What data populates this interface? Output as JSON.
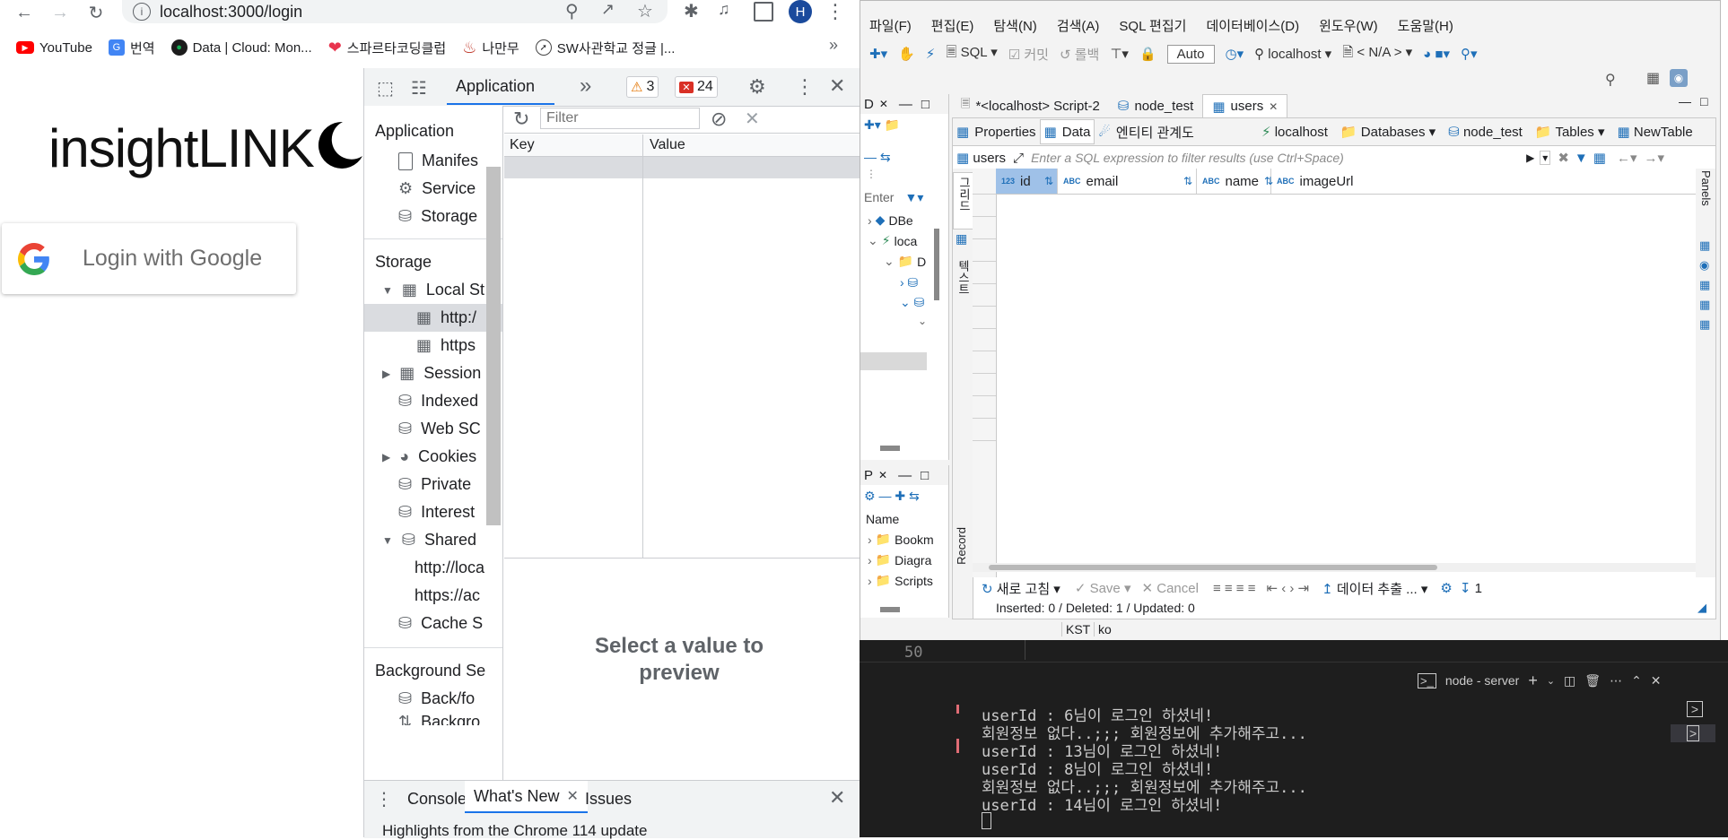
{
  "chrome": {
    "url": "localhost:3000/login",
    "profile_initial": "H",
    "bookmarks": [
      "YouTube",
      "번역",
      "Data | Cloud: Mon...",
      "스파르타코딩클럽",
      "나만무",
      "SW사관학교 정글 |..."
    ],
    "more": "»"
  },
  "page": {
    "logo_text": "insightLINK",
    "login_button": "Login with Google"
  },
  "devtools": {
    "active_tab": "Application",
    "warnings": "3",
    "errors": "24",
    "sidebar": {
      "application_header": "Application",
      "application_items": [
        "Manifes",
        "Service",
        "Storage"
      ],
      "storage_header": "Storage",
      "storage_items": [
        "Local St",
        "http:/",
        "https",
        "Session",
        "Indexed",
        "Web SC",
        "Cookies",
        "Private",
        "Interest",
        "Shared",
        "http://loca",
        "https://ac",
        "Cache S"
      ],
      "background_header": "Background Se",
      "background_items": [
        "Back/fo",
        "Backgro"
      ]
    },
    "filter_placeholder": "Filter",
    "columns": {
      "key": "Key",
      "value": "Value"
    },
    "preview_text": "Select a value to preview",
    "drawer_tabs": [
      "Console",
      "What's New",
      "Issues"
    ],
    "drawer_hint": "Highlights from the Chrome 114 update"
  },
  "dbeaver": {
    "menu": [
      "파일(F)",
      "편집(E)",
      "탐색(N)",
      "검색(A)",
      "SQL 편집기",
      "데이터베이스(D)",
      "윈도우(W)",
      "도움말(H)"
    ],
    "toolbar": {
      "sql": "SQL",
      "commit": "커밋",
      "rollback": "롤백",
      "mode": "Auto",
      "connection": "localhost",
      "schema": "< N/A >"
    },
    "nav_panel_title": "D",
    "nav_filter_placeholder": "Enter",
    "nav_items": [
      "DBe",
      "loca",
      "D"
    ],
    "project_panel_title": "P",
    "project_header": "Name",
    "project_items": [
      "Bookm",
      "Diagra",
      "Scripts"
    ],
    "editor_tabs": [
      "*<localhost> Script-2",
      "node_test",
      "users"
    ],
    "sub_tabs": [
      "Properties",
      "Data",
      "엔티티 관계도"
    ],
    "breadcrumbs": [
      "localhost",
      "Databases",
      "node_test",
      "Tables",
      "NewTable"
    ],
    "filter_table": "users",
    "filter_placeholder": "Enter a SQL expression to filter results (use Ctrl+Space)",
    "columns": [
      {
        "type": "123",
        "name": "id"
      },
      {
        "type": "ABC",
        "name": "email"
      },
      {
        "type": "ABC",
        "name": "name"
      },
      {
        "type": "ABC",
        "name": "imageUrl"
      }
    ],
    "side_labels": [
      "그리드",
      "텍스트",
      "Record"
    ],
    "right_label": "Panels",
    "bottom": {
      "refresh": "새로 고침",
      "save": "Save",
      "cancel": "Cancel",
      "export": "데이터 추출 ...",
      "count": "1"
    },
    "status": "Inserted: 0 / Deleted: 1 / Updated: 0",
    "status_bar": [
      "KST",
      "ko"
    ]
  },
  "terminal": {
    "line_number": "50",
    "title": "node - server",
    "lines": [
      "userId : 6님이 로그인 하셨네!",
      "회원정보 없다..;;; 회원정보에 추가해주고...",
      "userId : 13님이 로그인 하셨네!",
      "userId : 8님이 로그인 하셨네!",
      "회원정보 없다..;;; 회원정보에 추가해주고...",
      "userId : 14님이 로그인 하셨네!"
    ]
  }
}
